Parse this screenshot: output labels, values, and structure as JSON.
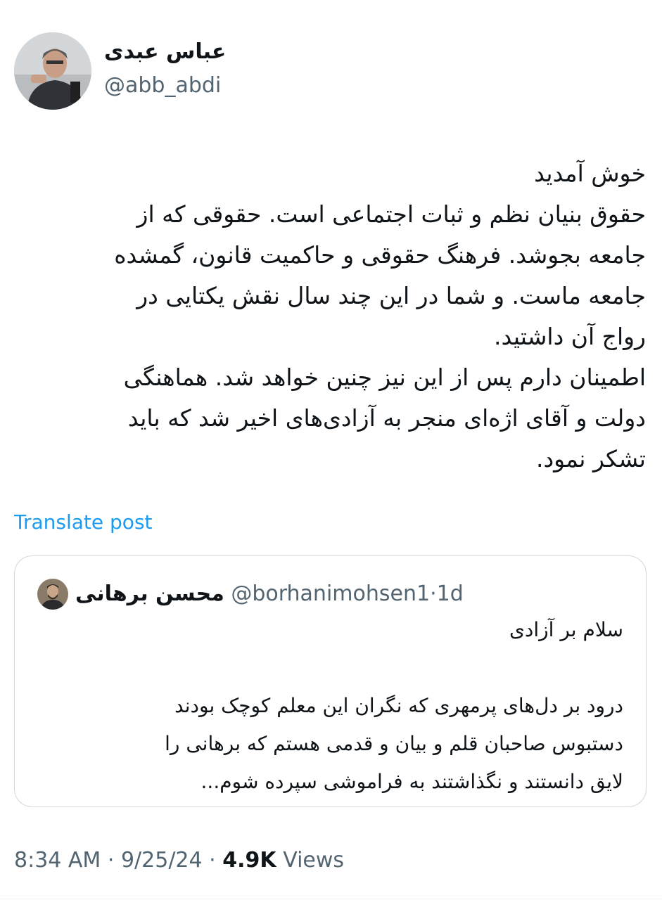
{
  "author": {
    "name": "عباس عبدی",
    "handle": "@abb_abdi"
  },
  "tweet": {
    "lines": [
      "خوش آمدید",
      "حقوق بنیان نظم و ثبات اجتماعی است. حقوقی که از",
      "جامعه بجوشد. فرهنگ حقوقی و حاکمیت قانون، گمشده",
      "جامعه ماست. و شما در این چند سال نقش یکتایی در",
      "رواج آن داشتید.",
      "اطمینان دارم پس از این نیز چنین خواهد شد. هماهنگی",
      "دولت و آقای اژه‌ای منجر به آزادی‌های اخیر شد که باید",
      "تشکر نمود."
    ],
    "translate_label": "Translate post"
  },
  "quoted": {
    "name": "محسن برهانی",
    "handle": "@borhanimohsen1",
    "separator": "·",
    "time": "1d",
    "lines": [
      "سلام بر آزادی",
      "درود بر دل‌های پرمهری که نگران این معلم کوچک بودند",
      "دستبوس صاحبان قلم و بیان و قدمی هستم که برهانی را",
      "لایق دانستند و نگذاشتند به فراموشی سپرده شوم..."
    ]
  },
  "meta": {
    "time": "8:34 AM",
    "separator": "·",
    "date": "9/25/24",
    "views_count": "4.9K",
    "views_label": "Views"
  },
  "colors": {
    "text": "#0f1419",
    "secondary": "#536471",
    "link": "#1d9bf0",
    "border": "#cfd9de"
  }
}
